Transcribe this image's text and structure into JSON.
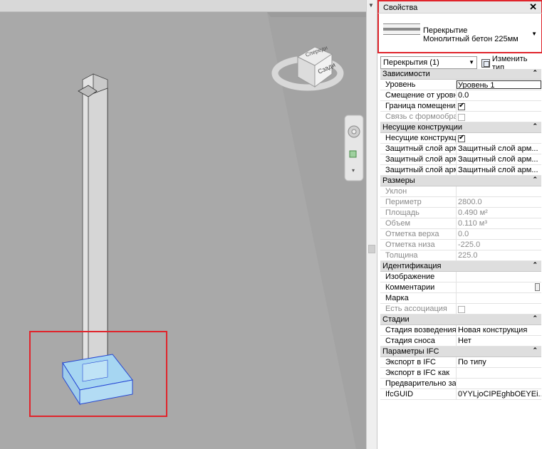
{
  "viewcube": {
    "face_top": "Спереди",
    "face_side": "Сзади"
  },
  "properties": {
    "title": "Свойства",
    "close": "✕",
    "type_line1": "Перекрытие",
    "type_line2": "Монолитный бетон 225мм",
    "filter": "Перекрытия (1)",
    "edit_type": "Изменить тип",
    "categories": [
      {
        "name": "Зависимости",
        "rows": [
          {
            "name": "Уровень",
            "value": "Уровень 1"
          },
          {
            "name": "Смещение от уровня",
            "value": "0.0"
          },
          {
            "name": "Граница помещения",
            "value": "",
            "check": "on"
          },
          {
            "name": "Связь с формообраз...",
            "value": "",
            "check": "grey"
          }
        ]
      },
      {
        "name": "Несущие конструкции",
        "rows": [
          {
            "name": "Несущие конструкц...",
            "value": "",
            "check": "on"
          },
          {
            "name": "Защитный слой арм...",
            "value": "Защитный слой арм..."
          },
          {
            "name": "Защитный слой арм...",
            "value": "Защитный слой арм..."
          },
          {
            "name": "Защитный слой арм...",
            "value": "Защитный слой арм..."
          }
        ]
      },
      {
        "name": "Размеры",
        "rows": [
          {
            "name": "Уклон",
            "value": ""
          },
          {
            "name": "Периметр",
            "value": "2800.0"
          },
          {
            "name": "Площадь",
            "value": "0.490 м²"
          },
          {
            "name": "Объем",
            "value": "0.110 м³"
          },
          {
            "name": "Отметка верха",
            "value": "0.0"
          },
          {
            "name": "Отметка низа",
            "value": "-225.0"
          },
          {
            "name": "Толщина",
            "value": "225.0"
          }
        ]
      },
      {
        "name": "Идентификация",
        "rows": [
          {
            "name": "Изображение",
            "value": ""
          },
          {
            "name": "Комментарии",
            "value": ""
          },
          {
            "name": "Марка",
            "value": ""
          },
          {
            "name": "Есть ассоциация",
            "value": "",
            "check": "grey"
          }
        ]
      },
      {
        "name": "Стадии",
        "rows": [
          {
            "name": "Стадия возведения",
            "value": "Новая конструкция"
          },
          {
            "name": "Стадия сноса",
            "value": "Нет"
          }
        ]
      },
      {
        "name": "Параметры IFC",
        "rows": [
          {
            "name": "Экспорт в IFC",
            "value": "По типу"
          },
          {
            "name": "Экспорт в IFC как",
            "value": ""
          },
          {
            "name": "Предварительно зад...",
            "value": ""
          },
          {
            "name": "IfcGUID",
            "value": "0YYLjoCIPEghbOEYEi..."
          }
        ]
      }
    ]
  }
}
